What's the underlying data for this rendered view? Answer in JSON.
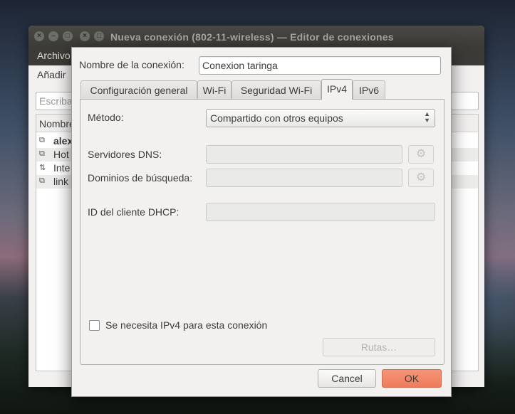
{
  "background_window": {
    "title": "Nueva conexión (802-11-wireless) — Editor de conexiones",
    "menu_first": "Archivo",
    "toolbar_add": "Añadir",
    "search_placeholder": "Escriba",
    "list_header": "Nombre",
    "rows": [
      {
        "icon": "wifi-icon",
        "label": "alex",
        "bold": true
      },
      {
        "icon": "wifi-icon",
        "label": "Hot",
        "bold": false
      },
      {
        "icon": "wired-icon",
        "label": "Inte",
        "bold": false
      },
      {
        "icon": "wifi-icon",
        "label": "link",
        "bold": false
      }
    ]
  },
  "dialog": {
    "connection_name_label": "Nombre de la conexión:",
    "connection_name_value": "Conexion taringa",
    "tabs": [
      {
        "label": "Configuración general",
        "active": false
      },
      {
        "label": "Wi-Fi",
        "active": false
      },
      {
        "label": "Seguridad Wi-Fi",
        "active": false
      },
      {
        "label": "IPv4",
        "active": true
      },
      {
        "label": "IPv6",
        "active": false
      }
    ],
    "ipv4": {
      "method_label": "Método:",
      "method_value": "Compartido con otros equipos",
      "dns_label": "Servidores DNS:",
      "dns_value": "",
      "search_domains_label": "Dominios de búsqueda:",
      "search_domains_value": "",
      "dhcp_client_id_label": "ID del cliente DHCP:",
      "dhcp_client_id_value": "",
      "require_ipv4_label": "Se necesita IPv4 para esta conexión",
      "require_ipv4_checked": false,
      "routes_button": "Rutas…"
    },
    "cancel_button": "Cancel",
    "ok_button": "OK"
  },
  "colors": {
    "ok_accent": "#ee7b5a",
    "titlebar": "#3c3b37",
    "dialog_bg": "#f2f1f0"
  }
}
